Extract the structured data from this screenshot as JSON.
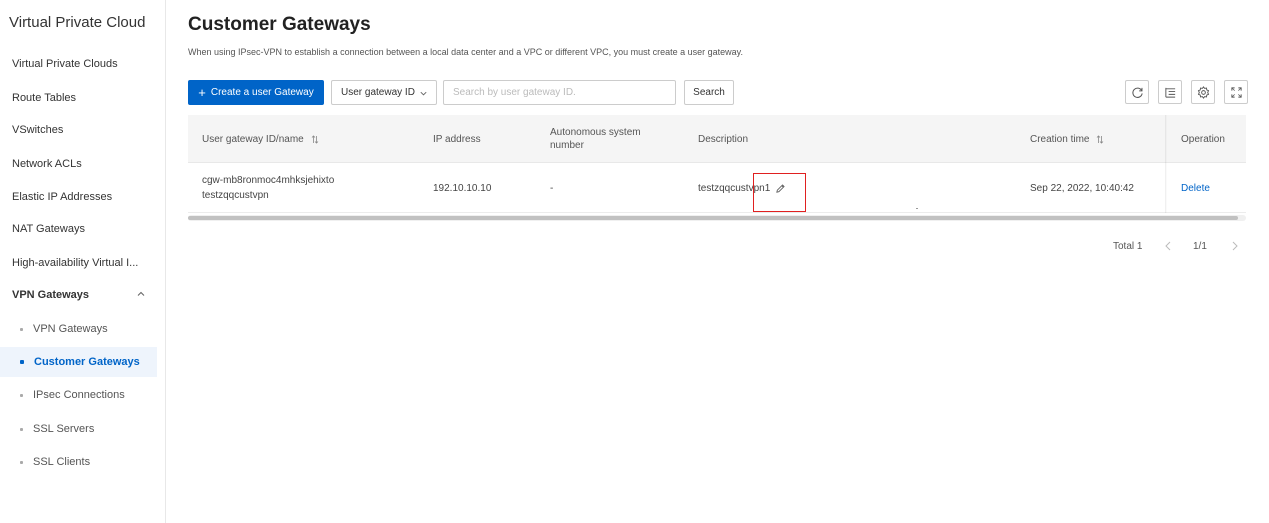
{
  "sidebar": {
    "title": "Virtual Private Cloud",
    "items": [
      {
        "label": "Virtual Private Clouds"
      },
      {
        "label": "Route Tables"
      },
      {
        "label": "VSwitches"
      },
      {
        "label": "Network ACLs"
      },
      {
        "label": "Elastic IP Addresses"
      },
      {
        "label": "NAT Gateways"
      },
      {
        "label": "High-availability Virtual I..."
      },
      {
        "label": "VPN Gateways"
      }
    ],
    "subitems": [
      {
        "label": "VPN Gateways"
      },
      {
        "label": "Customer Gateways"
      },
      {
        "label": "IPsec Connections"
      },
      {
        "label": "SSL Servers"
      },
      {
        "label": "SSL Clients"
      }
    ]
  },
  "header": {
    "title": "Customer Gateways",
    "description": "When using IPsec-VPN to establish a connection between a local data center and a VPC or different VPC, you must create a user gateway."
  },
  "toolbar": {
    "create_label": "Create a user Gateway",
    "filter_select": "User gateway ID",
    "search_placeholder": "Search by user gateway ID.",
    "search_label": "Search"
  },
  "table": {
    "columns": [
      "User gateway ID/name",
      "IP address",
      "Autonomous system number",
      "Description",
      "Creation time",
      "Operation"
    ],
    "rows": [
      {
        "id": "cgw-mb8ronmoc4mhksjehixto",
        "name": "testzqqcustvpn",
        "ip": "192.10.10.10",
        "asn": "-",
        "description": "testzqqcustvpn1",
        "created": "Sep 22, 2022, 10:40:42",
        "operation": "Delete"
      }
    ]
  },
  "pagination": {
    "total": "Total 1",
    "page": "1/1"
  },
  "colors": {
    "primary": "#0064c8",
    "highlight": "#e02020"
  }
}
